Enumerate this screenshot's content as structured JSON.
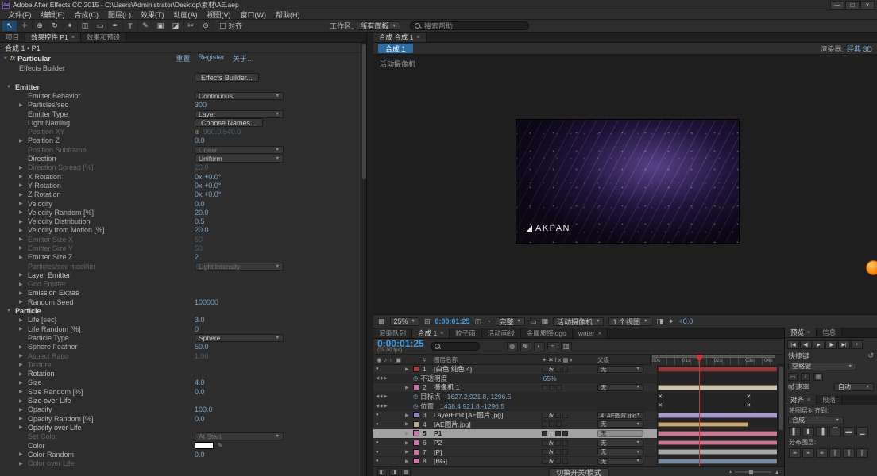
{
  "titlebar": {
    "title": "Adobe After Effects CC 2015 - C:\\Users\\Administrator\\Desktop\\素材\\AE.aep",
    "app_icon": "Ae",
    "window_buttons": [
      {
        "glyph": "—",
        "name": "minimize-button"
      },
      {
        "glyph": "□",
        "name": "maximize-button"
      },
      {
        "glyph": "×",
        "name": "close-button"
      }
    ]
  },
  "menus": [
    "文件(F)",
    "编辑(E)",
    "合成(C)",
    "图层(L)",
    "效果(T)",
    "动画(A)",
    "视图(V)",
    "窗口(W)",
    "帮助(H)"
  ],
  "toolbar": {
    "tools": [
      {
        "glyph": "↖",
        "name": "selection-tool-icon",
        "active": true
      },
      {
        "glyph": "✛",
        "name": "hand-tool-icon"
      },
      {
        "glyph": "⊕",
        "name": "zoom-tool-icon"
      },
      {
        "glyph": "↻",
        "name": "rotation-tool-icon"
      },
      {
        "glyph": "✦",
        "name": "camera-tool-icon"
      },
      {
        "glyph": "◫",
        "name": "pan-behind-tool-icon"
      },
      {
        "glyph": "▭",
        "name": "shape-tool-icon"
      },
      {
        "glyph": "✒",
        "name": "pen-tool-icon"
      },
      {
        "glyph": "T",
        "name": "type-tool-icon"
      },
      {
        "glyph": "✎",
        "name": "brush-tool-icon"
      },
      {
        "glyph": "▣",
        "name": "clone-stamp-tool-icon"
      },
      {
        "glyph": "◪",
        "name": "eraser-tool-icon"
      },
      {
        "glyph": "✂",
        "name": "roto-brush-tool-icon"
      },
      {
        "glyph": "⊙",
        "name": "puppet-pin-tool-icon"
      }
    ],
    "snap_label": "对齐",
    "workspace_label": "工作区:",
    "workspace_value": "所有面板",
    "search_placeholder": "搜索帮助"
  },
  "effect_controls": {
    "tabs": [
      {
        "label": "项目",
        "active": false
      },
      {
        "label": "效果控件 P1",
        "active": true
      },
      {
        "label": "效果和预设",
        "active": false
      }
    ],
    "breadcrumb": "合成 1 • P1",
    "effect_badge": "fx",
    "effect_name": "Particular",
    "links": [
      "重置",
      "Register",
      "关于…"
    ],
    "builder_label": "Effects Builder",
    "builder_button": "Effects Builder...",
    "rows": [
      {
        "t": "group",
        "n": "Emitter",
        "open": true
      },
      {
        "t": "dd",
        "n": "Emitter Behavior",
        "v": "Continuous"
      },
      {
        "t": "val",
        "n": "Particles/sec",
        "v": "300",
        "a": true
      },
      {
        "t": "dd",
        "n": "Emitter Type",
        "v": "Layer"
      },
      {
        "t": "btn",
        "n": "Light Naming",
        "v": "Choose Names..."
      },
      {
        "t": "val",
        "n": "Position XY",
        "v": "960.0,540.0",
        "dim": true,
        "icon": "⊕"
      },
      {
        "t": "val",
        "n": "Position Z",
        "v": "0.0",
        "a": true
      },
      {
        "t": "dd",
        "n": "Position Subframe",
        "v": "Linear",
        "dim": true
      },
      {
        "t": "dd",
        "n": "Direction",
        "v": "Uniform"
      },
      {
        "t": "val",
        "n": "Direction Spread [%]",
        "v": "20.0",
        "a": true,
        "dim": true
      },
      {
        "t": "val",
        "n": "X Rotation",
        "v": "0x +0.0°",
        "a": true
      },
      {
        "t": "val",
        "n": "Y Rotation",
        "v": "0x +0.0°",
        "a": true
      },
      {
        "t": "val",
        "n": "Z Rotation",
        "v": "0x +0.0°",
        "a": true
      },
      {
        "t": "val",
        "n": "Velocity",
        "v": "0.0",
        "a": true
      },
      {
        "t": "val",
        "n": "Velocity Random [%]",
        "v": "20.0",
        "a": true
      },
      {
        "t": "val",
        "n": "Velocity Distribution",
        "v": "0.5",
        "a": true
      },
      {
        "t": "val",
        "n": "Velocity from Motion [%]",
        "v": "20.0",
        "a": true
      },
      {
        "t": "val",
        "n": "Emitter Size X",
        "v": "50",
        "a": true,
        "dim": true
      },
      {
        "t": "val",
        "n": "Emitter Size Y",
        "v": "50",
        "a": true,
        "dim": true
      },
      {
        "t": "val",
        "n": "Emitter Size Z",
        "v": "2",
        "a": true
      },
      {
        "t": "dd",
        "n": "Particles/sec modifier",
        "v": "Light Intensity",
        "dim": true
      },
      {
        "t": "group2",
        "n": "Layer Emitter"
      },
      {
        "t": "group2",
        "n": "Grid Emitter",
        "dim": true
      },
      {
        "t": "group2",
        "n": "Emission Extras"
      },
      {
        "t": "val",
        "n": "Random Seed",
        "v": "100000",
        "a": true
      },
      {
        "t": "group",
        "n": "Particle",
        "open": true
      },
      {
        "t": "val",
        "n": "Life [sec]",
        "v": "3.0",
        "a": true
      },
      {
        "t": "val",
        "n": "Life Random [%]",
        "v": "0",
        "a": true
      },
      {
        "t": "dd",
        "n": "Particle Type",
        "v": "Sphere"
      },
      {
        "t": "val",
        "n": "Sphere Feather",
        "v": "50.0",
        "a": true
      },
      {
        "t": "val",
        "n": "Aspect Ratio",
        "v": "1.00",
        "a": true,
        "dim": true
      },
      {
        "t": "group2",
        "n": "Texture",
        "dim": true
      },
      {
        "t": "group2",
        "n": "Rotation"
      },
      {
        "t": "val",
        "n": "Size",
        "v": "4.0",
        "a": true
      },
      {
        "t": "val",
        "n": "Size Random [%]",
        "v": "0.0",
        "a": true
      },
      {
        "t": "group2",
        "n": "Size over Life"
      },
      {
        "t": "val",
        "n": "Opacity",
        "v": "100.0",
        "a": true
      },
      {
        "t": "val",
        "n": "Opacity Random [%]",
        "v": "0.0",
        "a": true
      },
      {
        "t": "group2",
        "n": "Opacity over Life"
      },
      {
        "t": "dd",
        "n": "Set Color",
        "v": "At Start",
        "dim": true
      },
      {
        "t": "color",
        "n": "Color",
        "swatch": "#ffffff"
      },
      {
        "t": "val",
        "n": "Color Random",
        "v": "0.0",
        "a": true
      },
      {
        "t": "group2",
        "n": "Color over Life",
        "dim": true
      }
    ]
  },
  "comp_panel": {
    "tab": "合成 合成 1",
    "comp_chip": "合成 1",
    "renderer_label": "渲染器:",
    "renderer_value": "经典 3D",
    "view_label": "活动摄像机",
    "viewer_logo": "AKPAN",
    "bottom_items": [
      {
        "t": "icon",
        "g": "▦",
        "name": "grid-guides-icon"
      },
      {
        "t": "dd",
        "v": "25%",
        "name": "magnification-dropdown"
      },
      {
        "t": "icon",
        "g": "⊞",
        "name": "mask-visibility-icon"
      },
      {
        "t": "tc",
        "v": "0:00:01:25",
        "name": "current-time"
      },
      {
        "t": "icon",
        "g": "◫",
        "name": "snapshot-icon"
      },
      {
        "t": "icon",
        "g": "◔",
        "name": "show-channel-icon"
      },
      {
        "t": "dd",
        "v": "完整",
        "name": "resolution-dropdown"
      },
      {
        "t": "icon",
        "g": "▭",
        "name": "region-of-interest-icon"
      },
      {
        "t": "icon",
        "g": "▦",
        "name": "transparency-grid-icon"
      },
      {
        "t": "dd",
        "v": "活动摄像机",
        "name": "active-camera-dropdown"
      },
      {
        "t": "dd",
        "v": "1 个视图",
        "name": "view-layout-dropdown"
      },
      {
        "t": "icon",
        "g": "◨",
        "name": "pixel-aspect-icon"
      },
      {
        "t": "icon",
        "g": "✦",
        "name": "fast-previews-icon"
      },
      {
        "t": "label",
        "v": "+0.0",
        "name": "exposure-value"
      }
    ]
  },
  "timeline": {
    "tabs": [
      {
        "label": "渲染队列",
        "active": false
      },
      {
        "label": "合成 1",
        "active": true
      },
      {
        "label": "粒子雨",
        "active": false
      },
      {
        "label": "活动画线",
        "active": false
      },
      {
        "label": "金属质感logo",
        "active": false
      },
      {
        "label": "water",
        "active": false,
        "closable": true
      }
    ],
    "timecode": "0:00:01:25",
    "fps": "(35.00 fps)",
    "tool_icons": [
      {
        "g": "◍",
        "name": "hide-shy-layers-icon"
      },
      {
        "g": "❆",
        "name": "frame-blending-icon"
      },
      {
        "g": "◐",
        "name": "motion-blur-icon"
      },
      {
        "g": "≈",
        "name": "graph-editor-icon"
      },
      {
        "g": "▥",
        "name": "brainstorm-icon"
      }
    ],
    "col_icons": [
      {
        "g": "◉",
        "name": "eye-column-icon"
      },
      {
        "g": "♪",
        "name": "audio-column-icon"
      },
      {
        "g": "○",
        "name": "solo-column-icon"
      },
      {
        "g": "▣",
        "name": "lock-column-icon"
      }
    ],
    "headers": {
      "name": "图层名称",
      "parent": "父级",
      "switches": "✦✱fx▦◐"
    },
    "ruler_labels": [
      ":00s",
      "01s",
      "02s",
      "03s",
      "04s"
    ],
    "layers": [
      {
        "num": "1",
        "name": "[白色 纯色 4]",
        "chip": "#b03a3a",
        "parent": "无",
        "fx": true,
        "eye": true,
        "bar": {
          "color": "#8e3a3a",
          "start": 0,
          "end": 1
        },
        "props": [
          {
            "name": "不透明度",
            "value": "65%"
          }
        ]
      },
      {
        "num": "2",
        "name": "摄像机 1",
        "chip": "#d86fb0",
        "parent": "无",
        "fx": false,
        "eye": false,
        "bar": {
          "color": "#cfc2ad",
          "start": 0,
          "end": 1
        },
        "props": [
          {
            "name": "目标点",
            "value": "1627.2,921.8,-1296.5",
            "keys": [
              0.02,
              0.72
            ]
          },
          {
            "name": "位置",
            "value": "1438.4,921.8,-1296.5",
            "keys": [
              0.02,
              0.72
            ]
          }
        ]
      },
      {
        "num": "3",
        "name": "LayerEmit [AE图片.jpg]",
        "chip": "#8f7fc0",
        "parent": "4. AE图片.jpg",
        "fx": true,
        "eye": true,
        "bar": {
          "color": "#a89ace",
          "start": 0,
          "end": 1
        }
      },
      {
        "num": "4",
        "name": "[AE图片.jpg]",
        "chip": "#b8a888",
        "parent": "无",
        "fx": false,
        "eye": true,
        "bar": {
          "color": "#c9a876",
          "start": 0,
          "end": 0.72
        }
      },
      {
        "num": "5",
        "name": "P1",
        "chip": "#d86fb0",
        "parent": "无",
        "fx": true,
        "eye": true,
        "selected": true,
        "bar": {
          "color": "#c87890",
          "start": 0,
          "end": 1
        }
      },
      {
        "num": "6",
        "name": "P2",
        "chip": "#d86fb0",
        "parent": "无",
        "fx": true,
        "eye": true,
        "bar": {
          "color": "#c87890",
          "start": 0,
          "end": 1
        }
      },
      {
        "num": "7",
        "name": "[P]",
        "chip": "#d86fb0",
        "parent": "无",
        "fx": true,
        "eye": true,
        "bar": {
          "color": "#a8a8a8",
          "start": 0,
          "end": 1
        }
      },
      {
        "num": "8",
        "name": "[BG]",
        "chip": "#d86fb0",
        "parent": "无",
        "fx": true,
        "eye": true,
        "bar": {
          "color": "#78889a",
          "start": 0,
          "end": 1
        }
      }
    ],
    "modes_button": "切换开关/模式"
  },
  "preview_panel": {
    "tabs": [
      {
        "label": "预览",
        "active": true
      },
      {
        "label": "信息",
        "active": false
      }
    ],
    "transport": [
      {
        "g": "|◀",
        "name": "first-frame-button"
      },
      {
        "g": "◀|",
        "name": "previous-frame-button"
      },
      {
        "g": "▶",
        "name": "play-button"
      },
      {
        "g": "|▶",
        "name": "next-frame-button"
      },
      {
        "g": "▶|",
        "name": "last-frame-button"
      },
      {
        "g": "♪",
        "name": "mute-audio-button"
      }
    ],
    "shortcut_label": "快捷键",
    "shortcut_value": "空格键",
    "include_icons": [
      {
        "g": "▭",
        "name": "include-video-icon"
      },
      {
        "g": "♪",
        "name": "include-audio-icon"
      },
      {
        "g": "▦",
        "name": "include-overlays-icon"
      }
    ],
    "framerate_label": "帧速率",
    "framerate_value": "自动"
  },
  "align_panel": {
    "tabs": [
      {
        "label": "对齐",
        "active": true
      },
      {
        "label": "段落",
        "active": false
      }
    ],
    "align_to_label": "将图层对齐到:",
    "align_to_value": "合成",
    "align_icons": [
      {
        "g": "▌",
        "name": "align-left-button"
      },
      {
        "g": "▮",
        "name": "align-horizontal-center-button"
      },
      {
        "g": "▐",
        "name": "align-right-button"
      },
      {
        "g": "▔",
        "name": "align-top-button"
      },
      {
        "g": "▬",
        "name": "align-vertical-center-button"
      },
      {
        "g": "▁",
        "name": "align-bottom-button"
      }
    ],
    "distribute_label": "分布图层:",
    "distribute_icons": [
      {
        "g": "≡",
        "name": "distribute-top-button"
      },
      {
        "g": "≡",
        "name": "distribute-vertical-center-button"
      },
      {
        "g": "≡",
        "name": "distribute-bottom-button"
      },
      {
        "g": "∥",
        "name": "distribute-left-button"
      },
      {
        "g": "∥",
        "name": "distribute-horizontal-center-button"
      },
      {
        "g": "∥",
        "name": "distribute-right-button"
      }
    ]
  },
  "colors": {
    "value_blue": "#7da7cf",
    "timecode_blue": "#3fa0e8",
    "cti_red": "#cf3333"
  }
}
